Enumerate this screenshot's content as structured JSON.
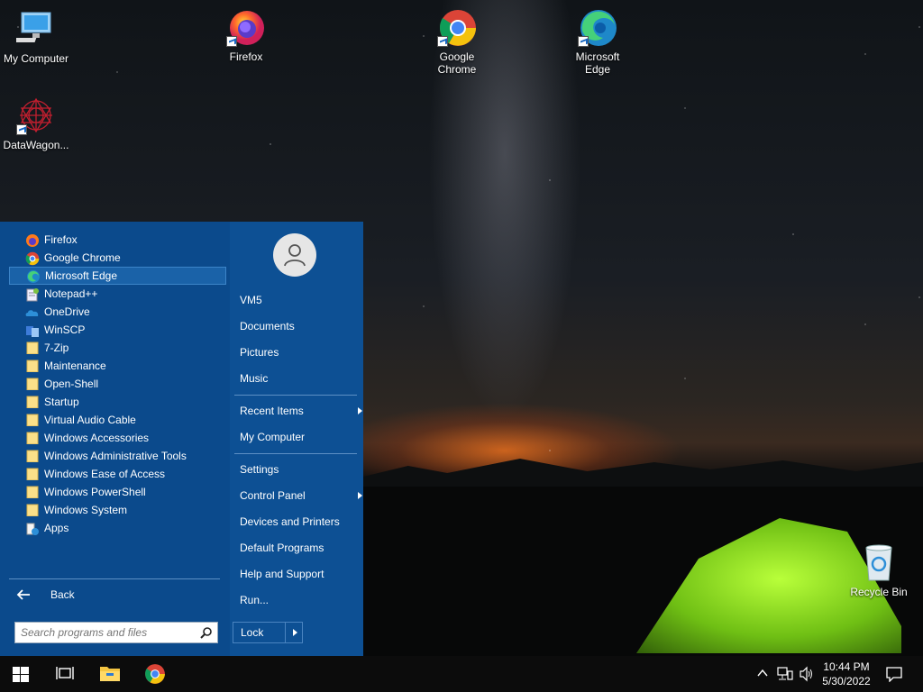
{
  "desktop": {
    "icons": [
      {
        "label": "My Computer"
      },
      {
        "label": "Firefox"
      },
      {
        "label": "Google Chrome",
        "line1": "Google",
        "line2": "Chrome"
      },
      {
        "label": "Microsoft Edge",
        "line1": "Microsoft",
        "line2": "Edge"
      },
      {
        "label": "DataWagon..."
      },
      {
        "label": "Recycle Bin"
      }
    ]
  },
  "start_menu": {
    "programs": [
      {
        "label": "Firefox",
        "icon": "firefox-icon"
      },
      {
        "label": "Google Chrome",
        "icon": "chrome-icon"
      },
      {
        "label": "Microsoft Edge",
        "icon": "edge-icon",
        "selected": true
      },
      {
        "label": "Notepad++",
        "icon": "notepadpp-icon"
      },
      {
        "label": "OneDrive",
        "icon": "onedrive-icon"
      },
      {
        "label": "WinSCP",
        "icon": "winscp-icon"
      },
      {
        "label": "7-Zip",
        "icon": "folder-icon"
      },
      {
        "label": "Maintenance",
        "icon": "folder-icon"
      },
      {
        "label": "Open-Shell",
        "icon": "folder-icon"
      },
      {
        "label": "Startup",
        "icon": "folder-icon"
      },
      {
        "label": "Virtual Audio Cable",
        "icon": "folder-icon"
      },
      {
        "label": "Windows Accessories",
        "icon": "folder-icon"
      },
      {
        "label": "Windows Administrative Tools",
        "icon": "folder-icon"
      },
      {
        "label": "Windows Ease of Access",
        "icon": "folder-icon"
      },
      {
        "label": "Windows PowerShell",
        "icon": "folder-icon"
      },
      {
        "label": "Windows System",
        "icon": "folder-icon"
      },
      {
        "label": "Apps",
        "icon": "apps-icon"
      }
    ],
    "back_label": "Back",
    "search_placeholder": "Search programs and files",
    "right": {
      "user": "VM5",
      "documents": "Documents",
      "pictures": "Pictures",
      "music": "Music",
      "recent_items": "Recent Items",
      "my_computer": "My Computer",
      "settings": "Settings",
      "control_panel": "Control Panel",
      "devices_printers": "Devices and Printers",
      "default_programs": "Default Programs",
      "help_support": "Help and Support",
      "run": "Run...",
      "lock": "Lock"
    }
  },
  "taskbar": {
    "time": "10:44 PM",
    "date": "5/30/2022"
  },
  "colors": {
    "menu_bg": "#0b4a8c",
    "menu_right_bg": "#0d5094",
    "selection": "#1a62a8",
    "taskbar": "#0c0c0c"
  }
}
